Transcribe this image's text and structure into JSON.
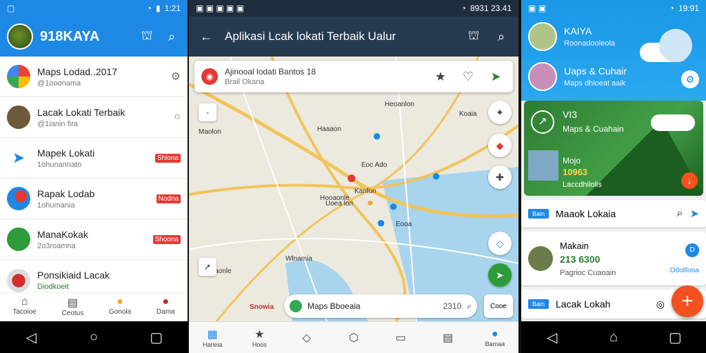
{
  "screen1": {
    "status_time": "1:21",
    "app_title": "918KAYA",
    "items": [
      {
        "title": "Maps Lodad..2017",
        "subtitle": "@1ooonama",
        "tag": ""
      },
      {
        "title": "Lacak Lokati Terbaik",
        "subtitle": "@1ianin fira",
        "tag": ""
      },
      {
        "title": "Mapek Lokati",
        "subtitle": "1ohunannato",
        "tag": "Shiona"
      },
      {
        "title": "Rapak Lodab",
        "subtitle": "1ohumania",
        "tag": "Nodna"
      },
      {
        "title": "ManaKokak",
        "subtitle": "2o3roamna",
        "tag": "Shoona"
      },
      {
        "title": "Ponsikiaid Lacak",
        "subtitle": "Diodkoeit",
        "tag": ""
      }
    ],
    "tabs": [
      "Tacoioe",
      "Ceotus",
      "Gonola",
      "Dama"
    ]
  },
  "screen2": {
    "status_time": "8931 23.41",
    "app_title": "Aplikasi Lcak lokati Terbaik Ualur",
    "search_title": "Ajinooal lodati Bantos 18",
    "search_subtitle": "Brail Okana",
    "map_labels": [
      "Maolon",
      "Haaaon",
      "Heoanlon",
      "Hooaonle",
      "Eoc Ado",
      "Kanfon",
      "Uoea lon",
      "Wlnamia",
      "Eooa",
      "Haonle",
      "Koaia",
      "Snowia"
    ],
    "placebar_label": "Maps Bboeaia",
    "placebar_num": "2310",
    "placebar_right": "Cooe",
    "tabs": [
      "Harieia",
      "Hoos",
      "",
      "",
      "",
      "",
      "Bamaa"
    ]
  },
  "screen3": {
    "status_time": "19:91",
    "profile_name": "KAIYA",
    "profile_sub": "Roonadooleola",
    "item2_title": "Uaps & Cuhair",
    "item2_sub": "Maps dhioeat aaik",
    "green_title": "VI3",
    "green_sub": "Maps & Cuahain",
    "green_label": "Mojo",
    "green_num": "10963",
    "green_small": "Laccdhilolis",
    "card1_badge": "Bain",
    "card1_title": "Maaok Lokaia",
    "card2_title": "Makain",
    "card2_num": "213 6300",
    "card2_sub": "Pagrioc Cuaoain",
    "card2_right": "Odolllooa",
    "card3_badge": "Bain",
    "card3_title": "Lacak Lokah"
  }
}
